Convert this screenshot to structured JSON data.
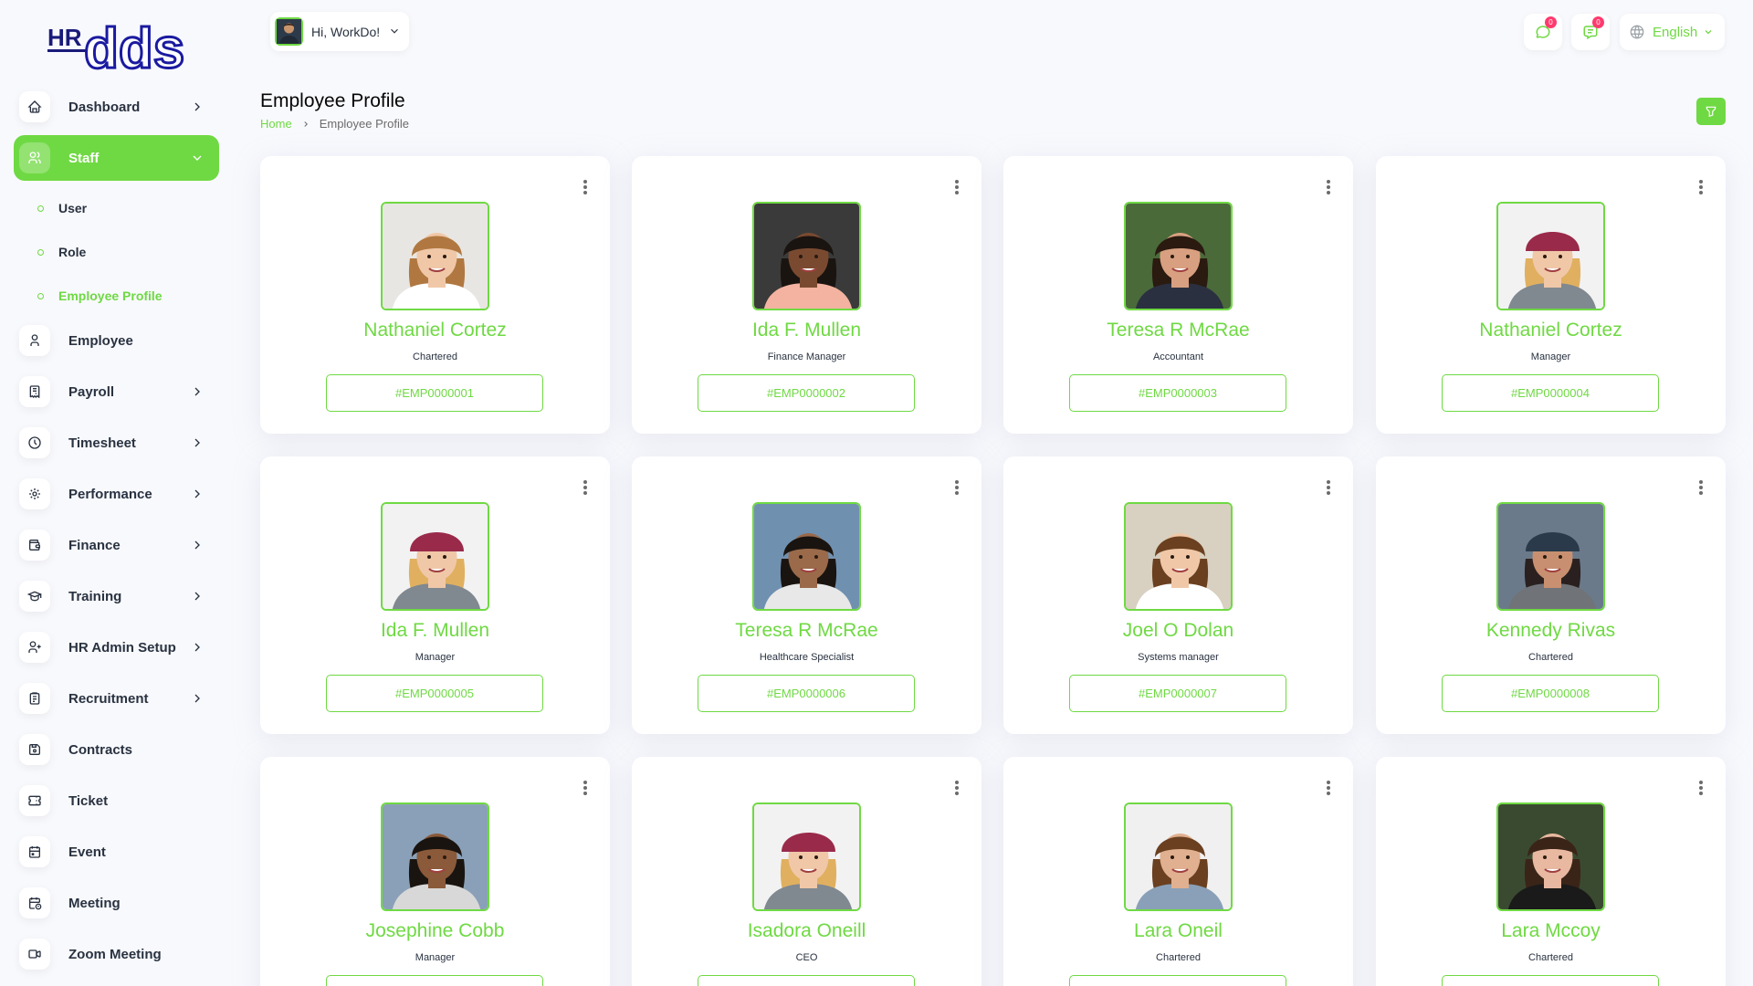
{
  "brand": {
    "logo_text_1": "HR",
    "logo_text_2": "dds"
  },
  "header": {
    "greeting": "Hi, WorkDo!",
    "chat_badge": "0",
    "messages_badge": "0",
    "language": "English"
  },
  "page": {
    "title": "Employee Profile",
    "breadcrumb_home": "Home",
    "breadcrumb_current": "Employee Profile"
  },
  "sidebar": {
    "items": [
      {
        "label": "Dashboard",
        "icon": "home-icon"
      },
      {
        "label": "Staff",
        "icon": "users-icon"
      },
      {
        "label": "Employee",
        "icon": "user-icon"
      },
      {
        "label": "Payroll",
        "icon": "receipt-icon"
      },
      {
        "label": "Timesheet",
        "icon": "clock-icon"
      },
      {
        "label": "Performance",
        "icon": "target-icon"
      },
      {
        "label": "Finance",
        "icon": "wallet-icon"
      },
      {
        "label": "Training",
        "icon": "school-icon"
      },
      {
        "label": "HR Admin Setup",
        "icon": "user-plus-icon"
      },
      {
        "label": "Recruitment",
        "icon": "clipboard-icon"
      },
      {
        "label": "Contracts",
        "icon": "device-floppy-icon"
      },
      {
        "label": "Ticket",
        "icon": "ticket-icon"
      },
      {
        "label": "Event",
        "icon": "calendar-event-icon"
      },
      {
        "label": "Meeting",
        "icon": "calendar-time-icon"
      },
      {
        "label": "Zoom Meeting",
        "icon": "video-icon"
      }
    ],
    "staff_sub": [
      {
        "label": "User"
      },
      {
        "label": "Role"
      },
      {
        "label": "Employee Profile"
      }
    ]
  },
  "employees": [
    {
      "name": "Nathaniel Cortez",
      "role": "Chartered",
      "id": "#EMP0000001"
    },
    {
      "name": "Ida F. Mullen",
      "role": "Finance Manager",
      "id": "#EMP0000002"
    },
    {
      "name": "Teresa R McRae",
      "role": "Accountant",
      "id": "#EMP0000003"
    },
    {
      "name": "Nathaniel Cortez",
      "role": "Manager",
      "id": "#EMP0000004"
    },
    {
      "name": "Ida F. Mullen",
      "role": "Manager",
      "id": "#EMP0000005"
    },
    {
      "name": "Teresa R McRae",
      "role": "Healthcare Specialist",
      "id": "#EMP0000006"
    },
    {
      "name": "Joel O Dolan",
      "role": "Systems manager",
      "id": "#EMP0000007"
    },
    {
      "name": "Kennedy Rivas",
      "role": "Chartered",
      "id": "#EMP0000008"
    },
    {
      "name": "Josephine Cobb",
      "role": "Manager",
      "id": ""
    },
    {
      "name": "Isadora Oneill",
      "role": "CEO",
      "id": ""
    },
    {
      "name": "Lara Oneil",
      "role": "Chartered",
      "id": ""
    },
    {
      "name": "Lara Mccoy",
      "role": "Chartered",
      "id": ""
    }
  ],
  "colors": {
    "accent": "#6fd943",
    "badge": "#ff3a6e",
    "text": "#293240"
  }
}
